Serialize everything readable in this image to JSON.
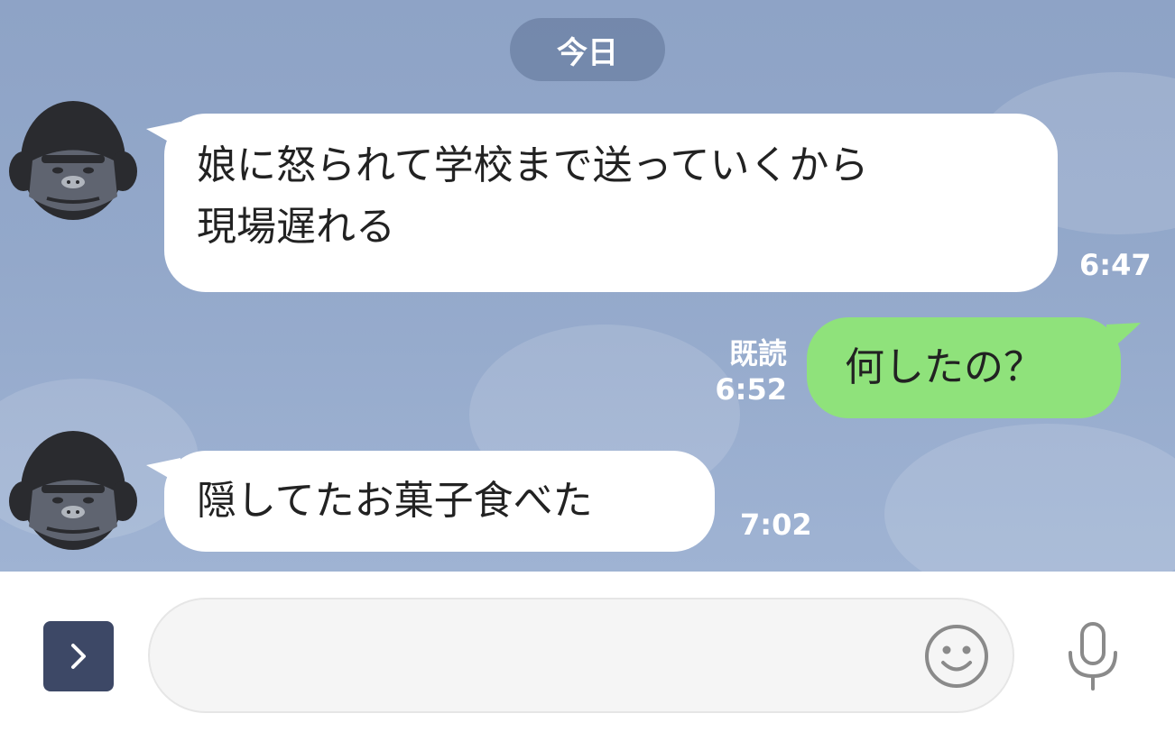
{
  "date_label": "今日",
  "messages": [
    {
      "direction": "incoming",
      "lines": [
        "娘に怒られて学校まで送っていくから",
        "現場遅れる"
      ],
      "time": "6:47",
      "avatar": "gorilla-avatar"
    },
    {
      "direction": "outgoing",
      "text": "何したの？",
      "read_label": "既読",
      "time": "6:52"
    },
    {
      "direction": "incoming",
      "text": "隠してたお菓子食べた",
      "time": "7:02",
      "avatar": "gorilla-avatar"
    }
  ],
  "input": {
    "value": "",
    "placeholder": ""
  },
  "icons": {
    "expand": "chevron-right-icon",
    "emoji": "smiley-icon",
    "mic": "microphone-icon"
  },
  "colors": {
    "background": "#93a8ca",
    "incoming_bubble": "#ffffff",
    "outgoing_bubble": "#8fe27b",
    "expand_button": "#3d4866"
  }
}
